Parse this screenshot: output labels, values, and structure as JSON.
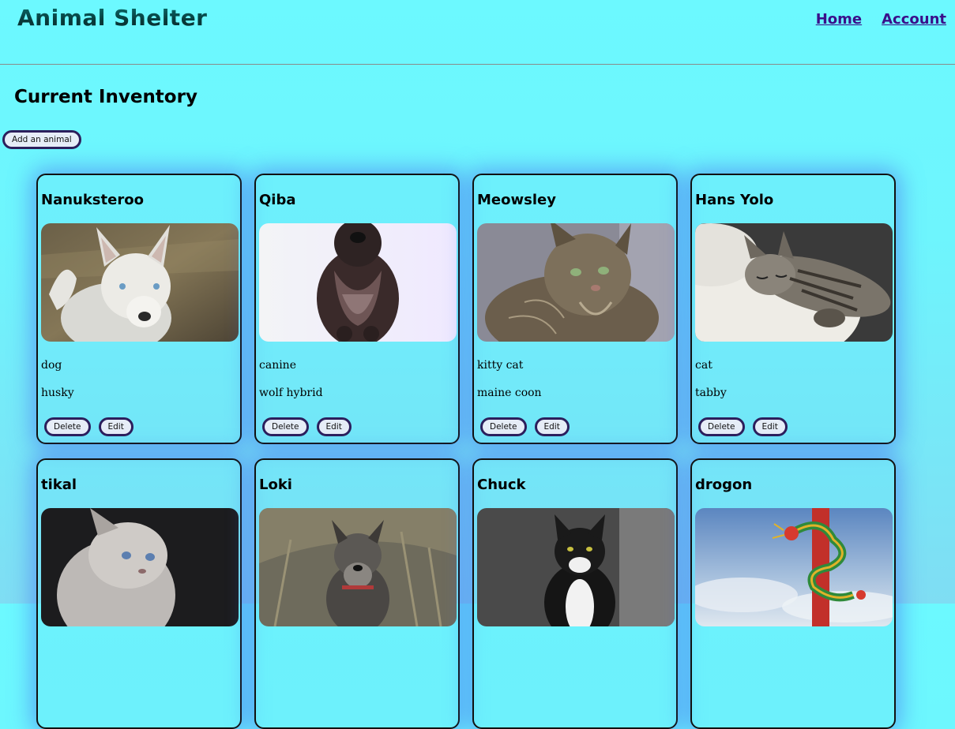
{
  "header": {
    "brand": "Animal Shelter",
    "nav": [
      {
        "label": "Home"
      },
      {
        "label": "Account"
      }
    ]
  },
  "main": {
    "title": "Current Inventory",
    "add_label": "Add an animal"
  },
  "card_actions": {
    "delete_label": "Delete",
    "edit_label": "Edit"
  },
  "animals": [
    {
      "name": "Nanuksteroo",
      "type": "dog",
      "breed": "husky",
      "photo": "white-husky-photo"
    },
    {
      "name": "Qiba",
      "type": "canine",
      "breed": "wolf hybrid",
      "photo": "dark-wolfdog-in-snow-photo"
    },
    {
      "name": "Meowsley",
      "type": "kitty cat",
      "breed": "maine coon",
      "photo": "fluffy-tabby-cat-photo"
    },
    {
      "name": "Hans Yolo",
      "type": "cat",
      "breed": "tabby",
      "photo": "sleeping-tabby-cat-photo"
    },
    {
      "name": "tikal",
      "type": "",
      "breed": "",
      "photo": "grey-persian-cat-photo"
    },
    {
      "name": "Loki",
      "type": "",
      "breed": "",
      "photo": "schnauzer-dog-photo"
    },
    {
      "name": "Chuck",
      "type": "",
      "breed": "",
      "photo": "tuxedo-cat-photo"
    },
    {
      "name": "drogon",
      "type": "",
      "breed": "",
      "photo": "dragon-statue-photo"
    }
  ]
}
